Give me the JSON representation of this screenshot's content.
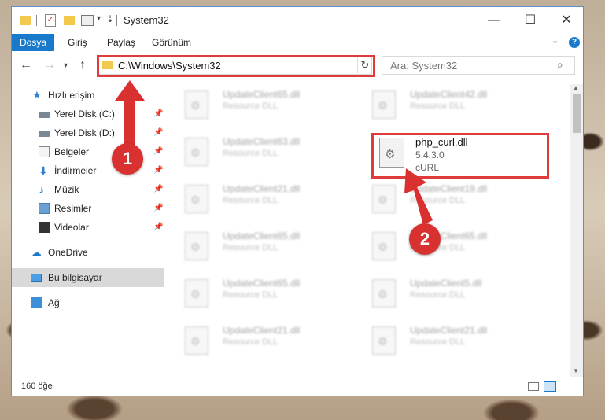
{
  "window": {
    "title": "System32",
    "controls": {
      "minimize": "—",
      "maximize": "☐",
      "close": "✕"
    }
  },
  "ribbon": {
    "tabs": [
      "Dosya",
      "Giriş",
      "Paylaş",
      "Görünüm"
    ],
    "help": "?"
  },
  "address": {
    "path": "C:\\Windows\\System32"
  },
  "search": {
    "placeholder": "Ara: System32"
  },
  "sidebar": {
    "items": [
      {
        "label": "Hızlı erişim",
        "icon": "star-icon"
      },
      {
        "label": "Yerel Disk (C:)",
        "icon": "drive-icon",
        "pinned": true
      },
      {
        "label": "Yerel Disk (D:)",
        "icon": "drive-icon",
        "pinned": true
      },
      {
        "label": "Belgeler",
        "icon": "documents-icon",
        "pinned": true
      },
      {
        "label": "İndirmeler",
        "icon": "download-icon",
        "pinned": true
      },
      {
        "label": "Müzik",
        "icon": "music-icon",
        "pinned": true
      },
      {
        "label": "Resimler",
        "icon": "pictures-icon",
        "pinned": true
      },
      {
        "label": "Videolar",
        "icon": "videos-icon",
        "pinned": true
      },
      {
        "label": "OneDrive",
        "icon": "cloud-icon"
      },
      {
        "label": "Bu bilgisayar",
        "icon": "computer-icon",
        "selected": true
      },
      {
        "label": "Ağ",
        "icon": "network-icon"
      }
    ]
  },
  "files": {
    "left": [
      {
        "name": "UpdateClient65.dll",
        "type": "Resource DLL"
      },
      {
        "name": "UpdateClient63.dll",
        "type": "Resource DLL"
      },
      {
        "name": "UpdateClient21.dll",
        "type": "Resource DLL"
      },
      {
        "name": "UpdateClient65.dll",
        "type": "Resource DLL"
      },
      {
        "name": "UpdateClient65.dll",
        "type": "Resource DLL"
      },
      {
        "name": "UpdateClient21.dll",
        "type": "Resource DLL"
      }
    ],
    "right": [
      {
        "name": "UpdateClient42.dll",
        "type": "Resource DLL"
      },
      {
        "name": "UpdateClient19.dll",
        "type": "Resource DLL"
      },
      {
        "name": "UpdateClient65.dll",
        "type": "Resource DLL"
      },
      {
        "name": "UpdateClient5.dll",
        "type": "Resource DLL"
      },
      {
        "name": "UpdateClient21.dll",
        "type": "Resource DLL"
      }
    ],
    "highlighted": {
      "name": "php_curl.dll",
      "version": "5.4.3.0",
      "company": "cURL"
    }
  },
  "status": {
    "count": "160 öğe"
  },
  "callouts": {
    "one": "1",
    "two": "2"
  },
  "colors": {
    "accent": "#1979ca",
    "highlight": "#e03b3b"
  }
}
